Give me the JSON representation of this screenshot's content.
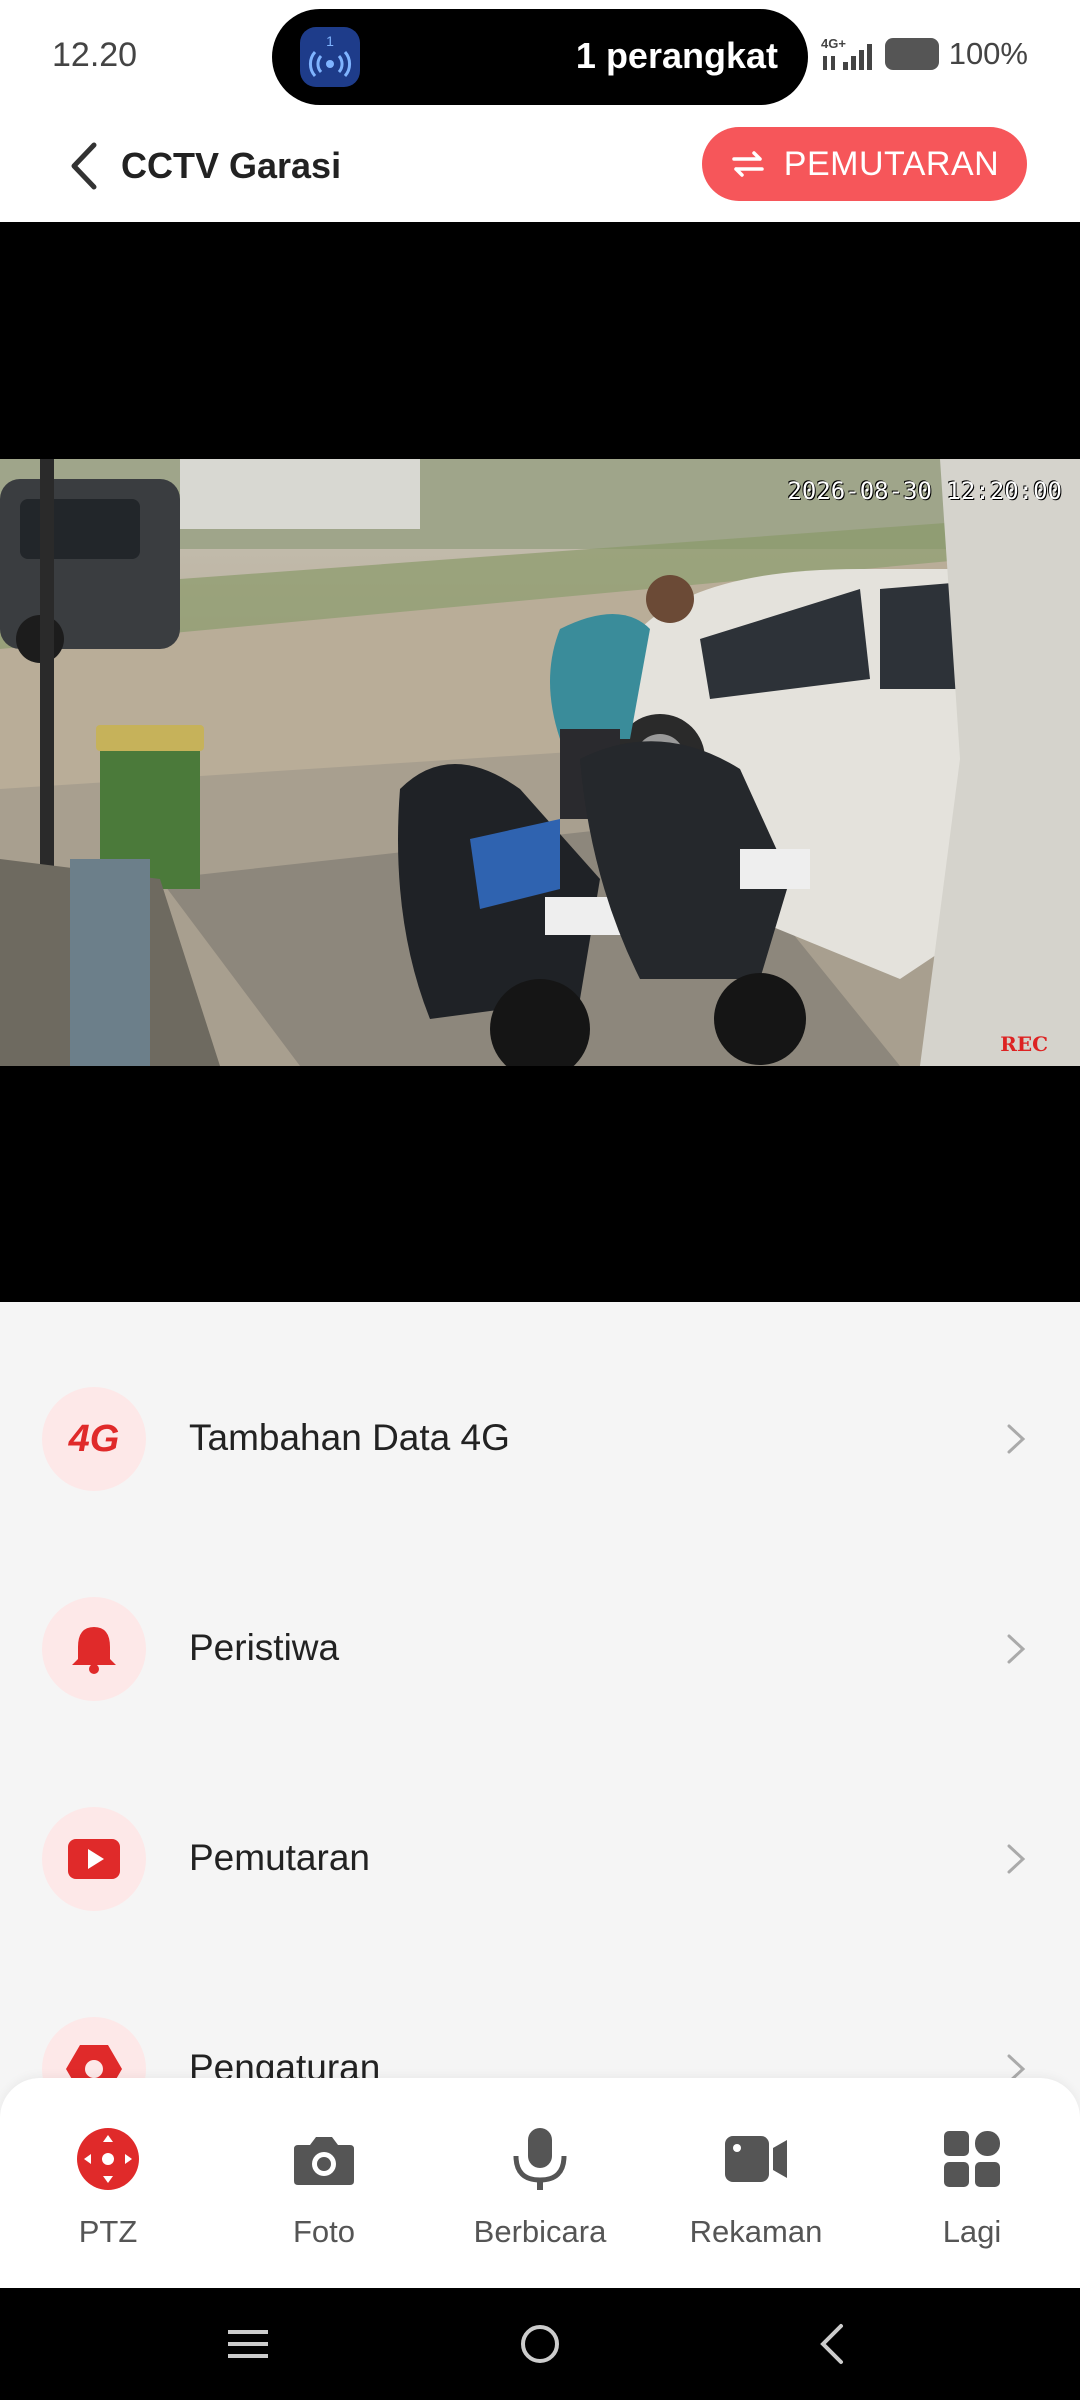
{
  "status_bar": {
    "time": "12.20",
    "island_badge": "1",
    "island_text": "1 perangkat",
    "network": "4G+",
    "battery": "100%"
  },
  "header": {
    "title": "CCTV Garasi",
    "playback_button": "PEMUTARAN",
    "accent_color": "#f6565a"
  },
  "video": {
    "timestamp": "2026-08-30 12:20:00",
    "rec_label": "REC"
  },
  "menu": {
    "items": [
      {
        "label": "Tambahan Data 4G",
        "icon": "4g-icon",
        "icon_text": "4G"
      },
      {
        "label": "Peristiwa",
        "icon": "alarm-bell-icon"
      },
      {
        "label": "Pemutaran",
        "icon": "play-video-icon"
      },
      {
        "label": "Pengaturan",
        "icon": "settings-hex-icon"
      }
    ]
  },
  "toolbar": {
    "items": [
      {
        "label": "PTZ",
        "icon": "ptz-icon",
        "active": true
      },
      {
        "label": "Foto",
        "icon": "camera-icon"
      },
      {
        "label": "Berbicara",
        "icon": "microphone-icon"
      },
      {
        "label": "Rekaman",
        "icon": "video-record-icon"
      },
      {
        "label": "Lagi",
        "icon": "grid-more-icon"
      }
    ]
  }
}
